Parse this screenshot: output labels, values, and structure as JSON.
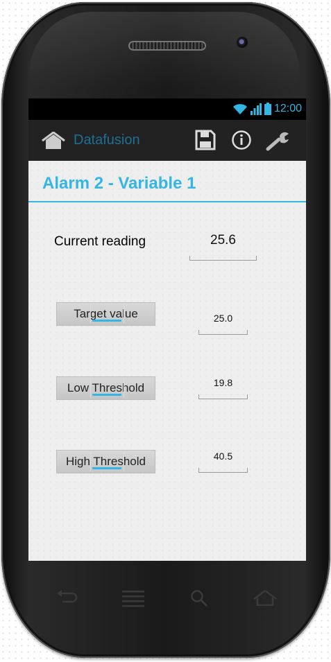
{
  "status_bar": {
    "time": "12:00",
    "icons": [
      "wifi-icon",
      "signal-icon",
      "battery-icon"
    ]
  },
  "action_bar": {
    "app_title": "Datafusion",
    "icons": [
      "home-icon",
      "save-icon",
      "info-icon",
      "wrench-icon"
    ]
  },
  "header": {
    "title": "Alarm 2 - Variable 1"
  },
  "current_reading": {
    "label": "Current reading",
    "value": "25.6"
  },
  "settings": [
    {
      "button_label": "Target value",
      "value": "25.0"
    },
    {
      "button_label": "Low Threshold",
      "value": "19.8"
    },
    {
      "button_label": "High Threshold",
      "value": "40.5"
    }
  ],
  "nav_bar": {
    "icons": [
      "back-icon",
      "menu-icon",
      "search-icon",
      "home-nav-icon"
    ]
  },
  "colors": {
    "accent": "#33b5e5",
    "action_bar": "#222222",
    "screen_bg": "#eeeeee"
  }
}
